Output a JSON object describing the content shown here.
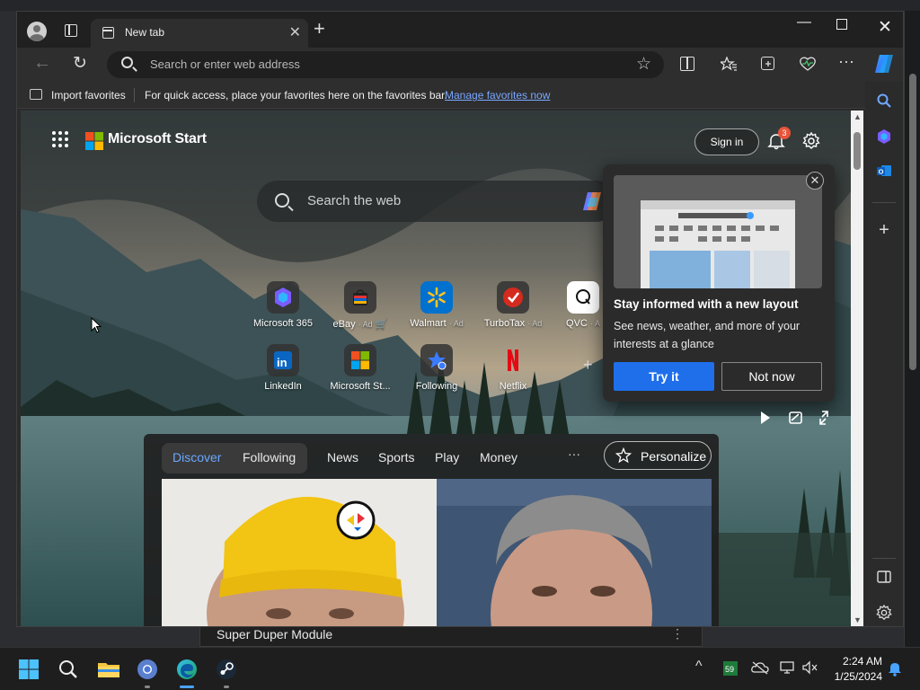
{
  "browser": {
    "tab_title": "New tab",
    "tab_close": "✕",
    "new_tab": "+",
    "win_minimize": "—",
    "win_close": "✕"
  },
  "toolbar": {
    "address_placeholder": "Search or enter web address",
    "back_icon": "←",
    "refresh_icon": "↻",
    "star_icon": "☆",
    "more_icon": "···"
  },
  "favorites_bar": {
    "import_label": "Import favorites",
    "tip_text": "For quick access, place your favorites here on the favorites bar.",
    "manage_link": "Manage favorites now"
  },
  "page": {
    "brand": "Microsoft Start",
    "sign_in": "Sign in",
    "notification_count": "3",
    "search_placeholder": "Search the web"
  },
  "quick_links": [
    {
      "label": "Microsoft 365",
      "ad": ""
    },
    {
      "label": "eBay",
      "ad": "· Ad"
    },
    {
      "label": "Walmart",
      "ad": "· Ad"
    },
    {
      "label": "TurboTax",
      "ad": "· Ad"
    },
    {
      "label": "QVC",
      "ad": "· A"
    },
    {
      "label": "LinkedIn",
      "ad": ""
    },
    {
      "label": "Microsoft St...",
      "ad": ""
    },
    {
      "label": "Following",
      "ad": ""
    },
    {
      "label": "Netflix",
      "ad": ""
    }
  ],
  "popup": {
    "close": "✕",
    "title": "Stay informed with a new layout",
    "description": "See news, weather, and more of your interests at a glance",
    "try_label": "Try it",
    "not_now_label": "Not now"
  },
  "feed": {
    "pill_discover": "Discover",
    "pill_following": "Following",
    "tabs": [
      "News",
      "Sports",
      "Play",
      "Money"
    ],
    "more": "···",
    "personalize": "Personalize"
  },
  "background_window": {
    "title": "Super Duper Module",
    "dots": "⋮"
  },
  "taskbar": {
    "time": "2:24 AM",
    "date": "1/25/2024",
    "tray_chevron": "^"
  },
  "colors": {
    "accent": "#1f6feb",
    "link": "#7aa7ff",
    "discover": "#6aa8ff",
    "badge": "#e8543a"
  }
}
